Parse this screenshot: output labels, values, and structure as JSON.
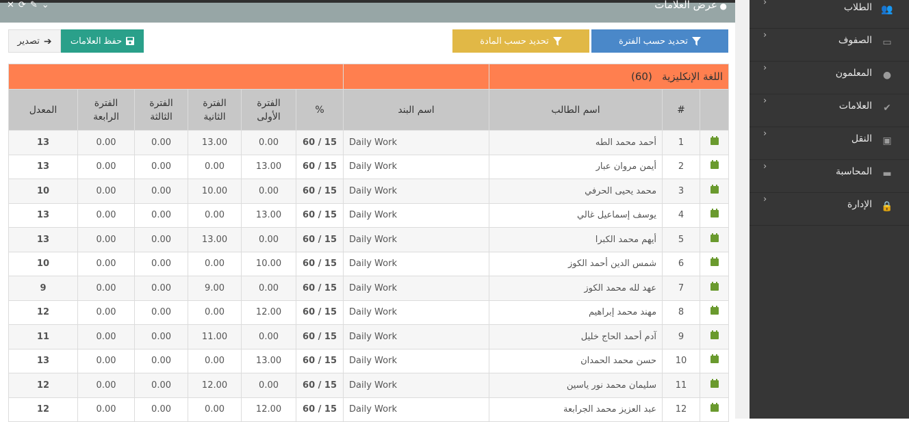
{
  "panel": {
    "title": "عرض العلامات",
    "tool_icons": [
      "close-icon",
      "refresh-icon",
      "wrench-icon",
      "chevron-down-icon"
    ]
  },
  "toolbar": {
    "filter_period": "تحديد حسب الفترة",
    "filter_subject": "تحديد حسب المادة",
    "save_marks": "حفظ العلامات",
    "export": "تصدير"
  },
  "sidebar": {
    "items": [
      {
        "label": "الطلاب",
        "icon": "users-icon"
      },
      {
        "label": "الصفوف",
        "icon": "laptop-icon"
      },
      {
        "label": "المعلمون",
        "icon": "user-icon"
      },
      {
        "label": "العلامات",
        "icon": "check-circle-icon"
      },
      {
        "label": "النقل",
        "icon": "bus-icon"
      },
      {
        "label": "المحاسبة",
        "icon": "money-icon"
      },
      {
        "label": "الإدارة",
        "icon": "lock-icon"
      }
    ]
  },
  "table": {
    "subject": "اللغة الإنكليزية",
    "subject_total": "(60)",
    "headers": {
      "num": "#",
      "student": "اسم الطالب",
      "item": "اسم البند",
      "pct": "%",
      "p1a": "الفترة",
      "p1b": "الأولى",
      "p2a": "الفترة",
      "p2b": "الثانية",
      "p3a": "الفترة",
      "p3b": "الثالثة",
      "p4a": "الفترة",
      "p4b": "الرابعة",
      "avg": "المعدل"
    },
    "rows": [
      {
        "num": "1",
        "name": "أحمد محمد الطه",
        "item": "Daily Work",
        "pct": "60 / 15",
        "p1": "0.00",
        "p2": "13.00",
        "p3": "0.00",
        "p4": "0.00",
        "avg": "13"
      },
      {
        "num": "2",
        "name": "أيمن مروان عبار",
        "item": "Daily Work",
        "pct": "60 / 15",
        "p1": "13.00",
        "p2": "0.00",
        "p3": "0.00",
        "p4": "0.00",
        "avg": "13"
      },
      {
        "num": "3",
        "name": "محمد يحيى الحرفي",
        "item": "Daily Work",
        "pct": "60 / 15",
        "p1": "0.00",
        "p2": "10.00",
        "p3": "0.00",
        "p4": "0.00",
        "avg": "10"
      },
      {
        "num": "4",
        "name": "يوسف إسماعيل غالي",
        "item": "Daily Work",
        "pct": "60 / 15",
        "p1": "13.00",
        "p2": "0.00",
        "p3": "0.00",
        "p4": "0.00",
        "avg": "13"
      },
      {
        "num": "5",
        "name": "أيهم محمد الكبرا",
        "item": "Daily Work",
        "pct": "60 / 15",
        "p1": "0.00",
        "p2": "13.00",
        "p3": "0.00",
        "p4": "0.00",
        "avg": "13"
      },
      {
        "num": "6",
        "name": "شمس الدين أحمد الكوز",
        "item": "Daily Work",
        "pct": "60 / 15",
        "p1": "10.00",
        "p2": "0.00",
        "p3": "0.00",
        "p4": "0.00",
        "avg": "10"
      },
      {
        "num": "7",
        "name": "عهد لله محمد الكوز",
        "item": "Daily Work",
        "pct": "60 / 15",
        "p1": "0.00",
        "p2": "9.00",
        "p3": "0.00",
        "p4": "0.00",
        "avg": "9"
      },
      {
        "num": "8",
        "name": "مهند محمد إبراهيم",
        "item": "Daily Work",
        "pct": "60 / 15",
        "p1": "12.00",
        "p2": "0.00",
        "p3": "0.00",
        "p4": "0.00",
        "avg": "12"
      },
      {
        "num": "9",
        "name": "آدم أحمد الحاج خليل",
        "item": "Daily Work",
        "pct": "60 / 15",
        "p1": "0.00",
        "p2": "11.00",
        "p3": "0.00",
        "p4": "0.00",
        "avg": "11"
      },
      {
        "num": "10",
        "name": "حسن محمد الحمدان",
        "item": "Daily Work",
        "pct": "60 / 15",
        "p1": "13.00",
        "p2": "0.00",
        "p3": "0.00",
        "p4": "0.00",
        "avg": "13"
      },
      {
        "num": "11",
        "name": "سليمان محمد نور ياسين",
        "item": "Daily Work",
        "pct": "60 / 15",
        "p1": "0.00",
        "p2": "12.00",
        "p3": "0.00",
        "p4": "0.00",
        "avg": "12"
      },
      {
        "num": "12",
        "name": "عبد العزيز محمد الجرابعة",
        "item": "Daily Work",
        "pct": "60 / 15",
        "p1": "12.00",
        "p2": "0.00",
        "p3": "0.00",
        "p4": "0.00",
        "avg": "12"
      }
    ]
  }
}
